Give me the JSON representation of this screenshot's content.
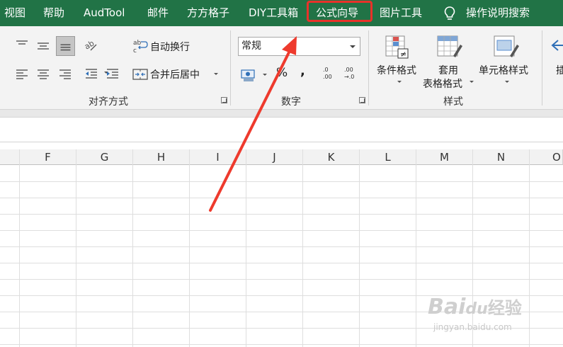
{
  "menu": {
    "tabs": [
      "视图",
      "帮助",
      "AudTool",
      "邮件",
      "方方格子",
      "DIY工具箱",
      "公式向导",
      "图片工具"
    ],
    "search_label": "操作说明搜索"
  },
  "ribbon": {
    "alignment": {
      "wrap_text": "自动换行",
      "merge_center": "合并后居中",
      "group_label": "对齐方式"
    },
    "number": {
      "format_value": "常规",
      "percent": "%",
      "comma": ",",
      "increase_decimal_top": ".0",
      "increase_decimal_bottom": ".00",
      "decrease_decimal_top": ".00",
      "decrease_decimal_bottom": "→.0",
      "group_label": "数字"
    },
    "styles": {
      "conditional_format": "条件格式",
      "table_format_line1": "套用",
      "table_format_line2": "表格格式",
      "cell_styles": "单元格样式",
      "group_label": "样式"
    },
    "cells": {
      "insert_partial": "插"
    }
  },
  "columns": [
    "F",
    "G",
    "H",
    "I",
    "J",
    "K",
    "L",
    "M",
    "N",
    "O"
  ],
  "watermark": {
    "brand": "Bai",
    "paw": "du",
    "suffix": "经验",
    "url": "jingyan.baidu.com"
  },
  "colors": {
    "menu_bg": "#217346",
    "highlight": "#e8322a",
    "arrow": "#ee3a2d"
  }
}
